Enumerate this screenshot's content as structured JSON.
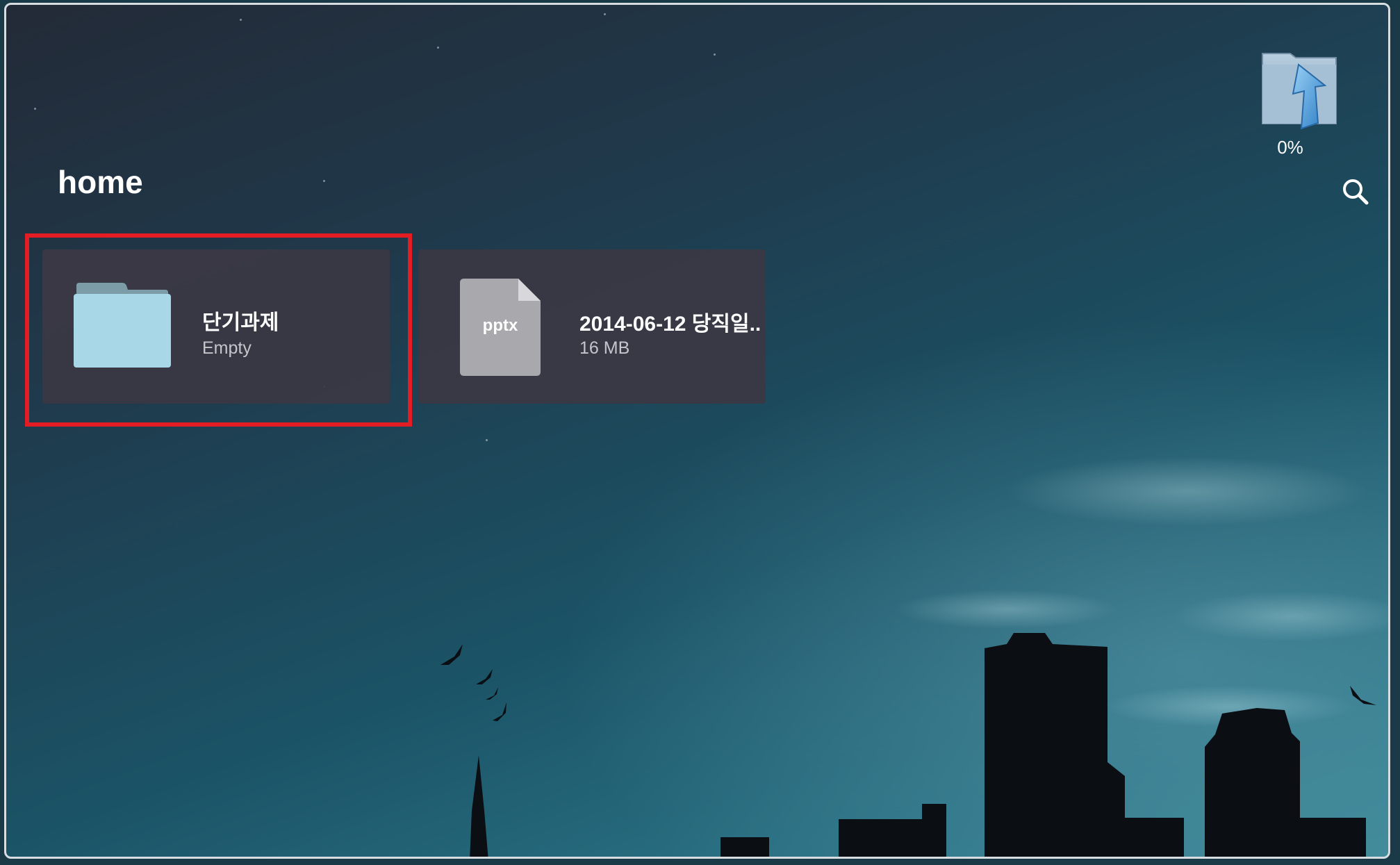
{
  "page": {
    "title": "home"
  },
  "upload": {
    "percent_label": "0%"
  },
  "items": [
    {
      "name": "단기과제",
      "detail": "Empty",
      "type": "folder"
    },
    {
      "name": "2014-06-12 당직일..",
      "detail": "16 MB",
      "type": "file",
      "ext": "pptx"
    }
  ],
  "icons": {
    "search": "search-icon",
    "upload": "upload-folder-icon",
    "folder": "folder-icon",
    "file": "file-icon"
  },
  "colors": {
    "highlight": "#e41c24",
    "card_bg": "#3a3844",
    "folder": "#a8d8e8",
    "file": "#a9a9ad"
  }
}
